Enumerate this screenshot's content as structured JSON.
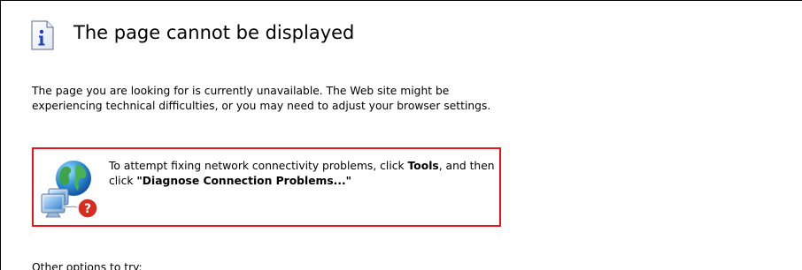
{
  "page": {
    "title": "The page cannot be displayed",
    "body_text": "The page you are looking for is currently unavailable. The Web site might be experiencing technical difficulties, or you may need to adjust your browser settings.",
    "tip": {
      "text_before": "To attempt fixing network connectivity problems, click ",
      "tools_label": "Tools",
      "text_middle": ", and then click ",
      "diagnose_label": "\"Diagnose Connection Problems...\"",
      "highlight_color": "#e8141b"
    },
    "other_options_label": "Other options to try:"
  },
  "icons": {
    "header_icon": "info-icon",
    "tip_icon": "network-diagnose-icon"
  }
}
